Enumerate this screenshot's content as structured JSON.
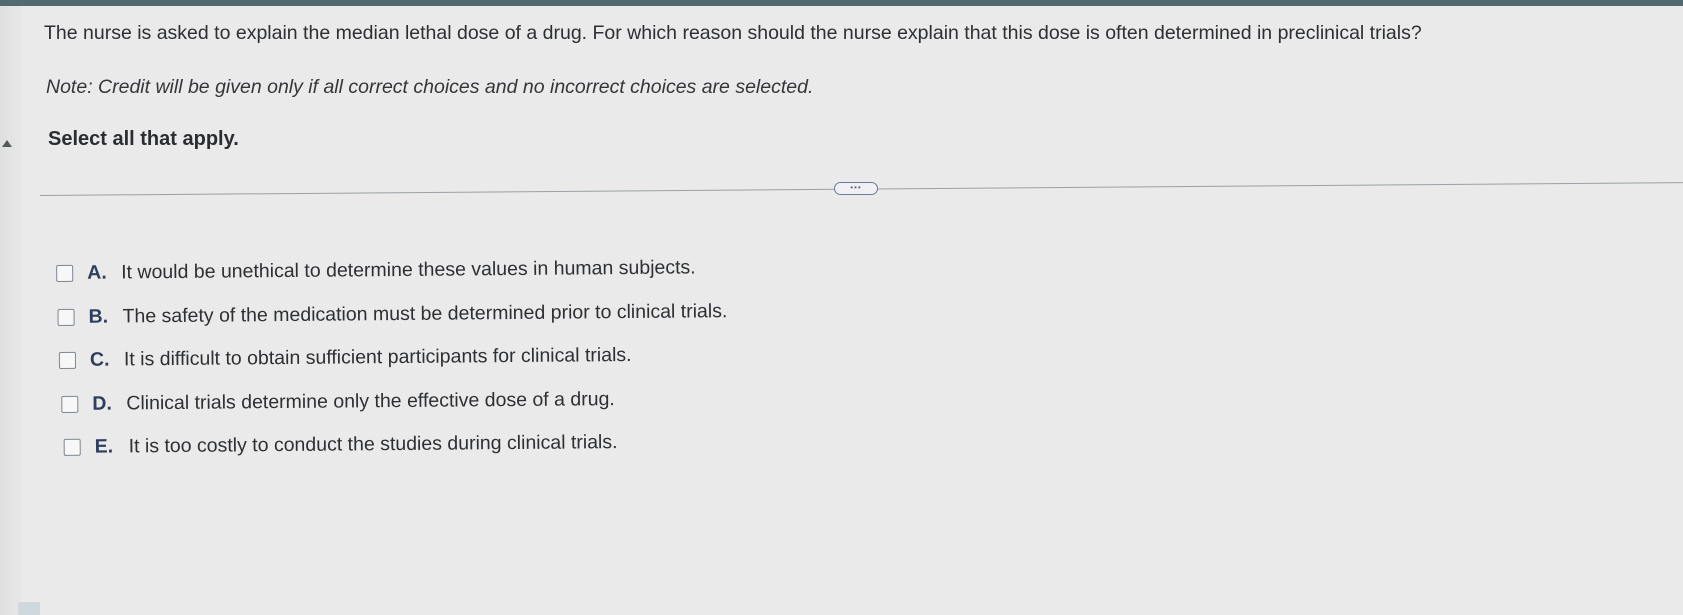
{
  "question": {
    "text": "The nurse is asked to explain the median lethal dose of a drug. For which reason should the nurse explain that this dose is often determined in preclinical trials?",
    "note": "Note: Credit will be given only if all correct choices and no incorrect choices are selected.",
    "instruction": "Select all that apply."
  },
  "divider": {
    "more_label": "•••"
  },
  "options": [
    {
      "letter": "A.",
      "text": "It would be unethical to determine these values in human subjects."
    },
    {
      "letter": "B.",
      "text": "The safety of the medication must be determined prior to clinical trials."
    },
    {
      "letter": "C.",
      "text": "It is difficult to obtain sufficient participants for clinical trials."
    },
    {
      "letter": "D.",
      "text": "Clinical trials determine only the effective dose of a drug."
    },
    {
      "letter": "E.",
      "text": "It is too costly to conduct the studies during clinical trials."
    }
  ],
  "colors": {
    "background": "#e9eae9",
    "top_bar": "#4f6a70",
    "option_letter": "#2e3e5c"
  }
}
